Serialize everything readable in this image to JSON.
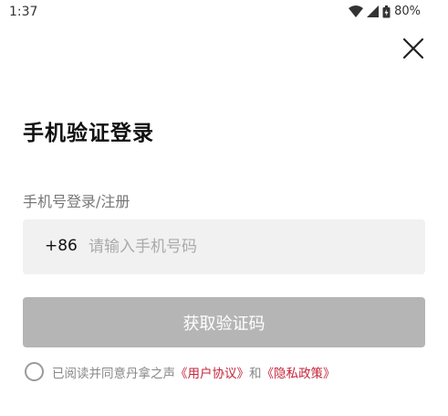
{
  "status_bar": {
    "time": "1:37",
    "battery": "80%",
    "icons": [
      "wifi-icon",
      "signal-icon",
      "battery-icon"
    ]
  },
  "close_icon": "close-icon",
  "title": "手机验证登录",
  "subtitle": "手机号登录/注册",
  "phone": {
    "country_code": "+86",
    "placeholder": "请输入手机号码",
    "value": ""
  },
  "get_code_button": "获取验证码",
  "agreement": {
    "prefix": "已阅读并同意丹拿之声",
    "user_agreement": "《用户协议》",
    "joiner": "和",
    "privacy_policy": "《隐私政策》",
    "checked": false
  },
  "colors": {
    "link": "#c4243b",
    "button_disabled": "#b5b5b5",
    "input_bg": "#f1f1f1"
  }
}
